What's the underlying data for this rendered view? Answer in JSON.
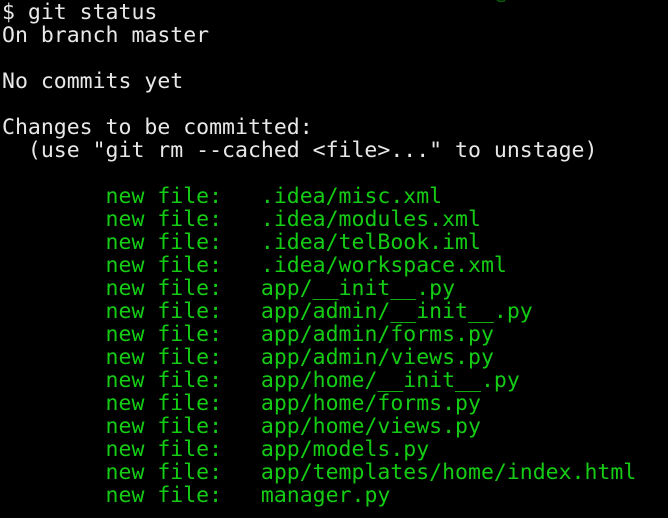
{
  "terminal": {
    "background_color": "#000000",
    "prompt_text_color": "#e8e8e8",
    "staged_text_color": "#15cc15",
    "clipped_top_line": "e",
    "prompt_symbol": "$",
    "command_line": "$ git status",
    "branch_line": "On branch master",
    "blank_1": " ",
    "no_commits_line": "No commits yet",
    "blank_2": " ",
    "changes_header": "Changes to be committed:",
    "hint_line": "  (use \"git rm --cached <file>...\" to unstage)",
    "blank_3": " ",
    "status_label": "        new file:   ",
    "files": [
      {
        "status": "        new file:   ",
        "path": ".idea/misc.xml"
      },
      {
        "status": "        new file:   ",
        "path": ".idea/modules.xml"
      },
      {
        "status": "        new file:   ",
        "path": ".idea/telBook.iml"
      },
      {
        "status": "        new file:   ",
        "path": ".idea/workspace.xml"
      },
      {
        "status": "        new file:   ",
        "path": "app/__init__.py"
      },
      {
        "status": "        new file:   ",
        "path": "app/admin/__init__.py"
      },
      {
        "status": "        new file:   ",
        "path": "app/admin/forms.py"
      },
      {
        "status": "        new file:   ",
        "path": "app/admin/views.py"
      },
      {
        "status": "        new file:   ",
        "path": "app/home/__init__.py"
      },
      {
        "status": "        new file:   ",
        "path": "app/home/forms.py"
      },
      {
        "status": "        new file:   ",
        "path": "app/home/views.py"
      },
      {
        "status": "        new file:   ",
        "path": "app/models.py"
      },
      {
        "status": "        new file:   ",
        "path": "app/templates/home/index.html"
      },
      {
        "status": "        new file:   ",
        "path": "manager.py"
      }
    ]
  }
}
